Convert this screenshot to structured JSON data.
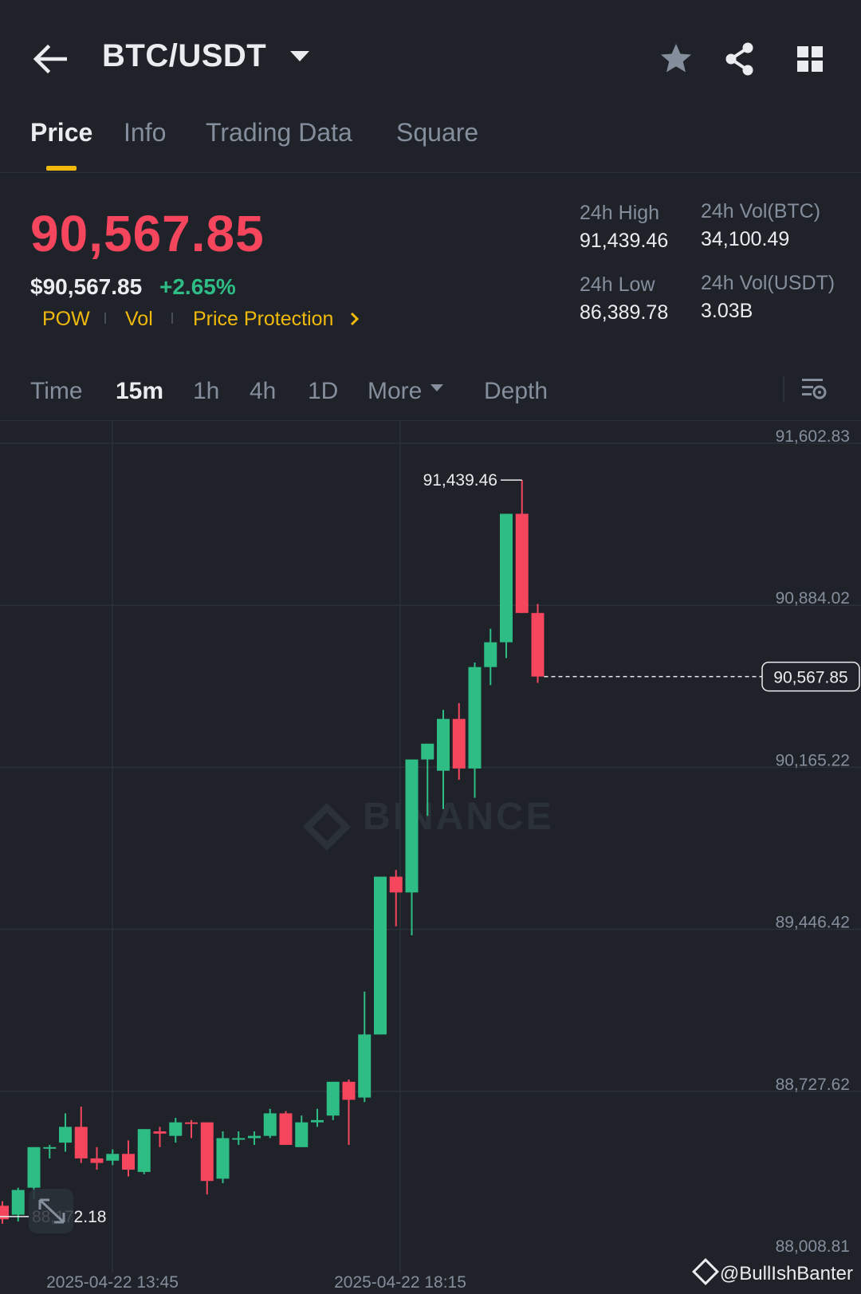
{
  "header": {
    "pair": "BTC/USDT",
    "icons": [
      "back-arrow-icon",
      "star-icon",
      "share-icon",
      "grid-icon"
    ]
  },
  "tabs": [
    {
      "label": "Price",
      "active": true
    },
    {
      "label": "Info",
      "active": false
    },
    {
      "label": "Trading Data",
      "active": false
    },
    {
      "label": "Square",
      "active": false
    }
  ],
  "price": {
    "last": "90,567.85",
    "usd": "$90,567.85",
    "change_pct": "+2.65%",
    "tags": [
      "POW",
      "Vol",
      "Price Protection"
    ]
  },
  "stats": {
    "high_label": "24h High",
    "high_value": "91,439.46",
    "low_label": "24h Low",
    "low_value": "86,389.78",
    "vol_btc_label": "24h Vol(BTC)",
    "vol_btc_value": "34,100.49",
    "vol_usdt_label": "24h Vol(USDT)",
    "vol_usdt_value": "3.03B"
  },
  "intervals": {
    "items": [
      "Time",
      "15m",
      "1h",
      "4h",
      "1D",
      "More"
    ],
    "active": "15m",
    "depth": "Depth"
  },
  "colors": {
    "up": "#2ebd85",
    "down": "#f6465d",
    "accent": "#f0b90b",
    "bg": "#1f2329"
  },
  "watermark": "BINANCE",
  "credit": "@BullIshBanter",
  "chart_data": {
    "type": "candlestick",
    "interval": "15m",
    "y_ticks": [
      "91,602.83",
      "90,884.02",
      "90,165.22",
      "89,446.42",
      "88,727.62",
      "88,008.81"
    ],
    "x_ticks": [
      "2025-04-22 13:45",
      "2025-04-22 18:15"
    ],
    "ylim": [
      88008.81,
      91602.83
    ],
    "high_marker": {
      "label": "91,439.46",
      "value": 91439.46
    },
    "low_marker": {
      "label": "88,172.18",
      "value": 88172.18
    },
    "last_price": {
      "label": "90,567.85",
      "value": 90567.85
    },
    "candles": [
      {
        "o": 88220,
        "h": 88240,
        "c": 88160,
        "l": 88140
      },
      {
        "o": 88180,
        "h": 88300,
        "c": 88290,
        "l": 88150
      },
      {
        "o": 88300,
        "h": 88480,
        "c": 88480,
        "l": 88250
      },
      {
        "o": 88480,
        "h": 88490,
        "c": 88480,
        "l": 88430
      },
      {
        "o": 88500,
        "h": 88630,
        "c": 88570,
        "l": 88460
      },
      {
        "o": 88570,
        "h": 88660,
        "c": 88430,
        "l": 88410
      },
      {
        "o": 88430,
        "h": 88480,
        "c": 88410,
        "l": 88380
      },
      {
        "o": 88420,
        "h": 88470,
        "c": 88450,
        "l": 88400
      },
      {
        "o": 88450,
        "h": 88510,
        "c": 88380,
        "l": 88350
      },
      {
        "o": 88370,
        "h": 88560,
        "c": 88560,
        "l": 88360
      },
      {
        "o": 88550,
        "h": 88570,
        "c": 88540,
        "l": 88480
      },
      {
        "o": 88530,
        "h": 88610,
        "c": 88590,
        "l": 88500
      },
      {
        "o": 88590,
        "h": 88600,
        "c": 88585,
        "l": 88520
      },
      {
        "o": 88590,
        "h": 88590,
        "c": 88330,
        "l": 88270
      },
      {
        "o": 88340,
        "h": 88550,
        "c": 88520,
        "l": 88320
      },
      {
        "o": 88520,
        "h": 88550,
        "c": 88520,
        "l": 88490
      },
      {
        "o": 88520,
        "h": 88550,
        "c": 88530,
        "l": 88490
      },
      {
        "o": 88530,
        "h": 88650,
        "c": 88630,
        "l": 88520
      },
      {
        "o": 88630,
        "h": 88640,
        "c": 88490,
        "l": 88490
      },
      {
        "o": 88480,
        "h": 88620,
        "c": 88590,
        "l": 88480
      },
      {
        "o": 88590,
        "h": 88650,
        "c": 88600,
        "l": 88570
      },
      {
        "o": 88620,
        "h": 88770,
        "c": 88770,
        "l": 88600
      },
      {
        "o": 88770,
        "h": 88780,
        "c": 88690,
        "l": 88490
      },
      {
        "o": 88700,
        "h": 89170,
        "c": 88980,
        "l": 88680
      },
      {
        "o": 88980,
        "h": 89680,
        "c": 89680,
        "l": 88980
      },
      {
        "o": 89680,
        "h": 89710,
        "c": 89610,
        "l": 89460
      },
      {
        "o": 89610,
        "h": 90200,
        "c": 90200,
        "l": 89420
      },
      {
        "o": 90200,
        "h": 90270,
        "c": 90270,
        "l": 89950
      },
      {
        "o": 90150,
        "h": 90420,
        "c": 90380,
        "l": 89980
      },
      {
        "o": 90380,
        "h": 90450,
        "c": 90160,
        "l": 90110
      },
      {
        "o": 90160,
        "h": 90630,
        "c": 90610,
        "l": 90030
      },
      {
        "o": 90610,
        "h": 90780,
        "c": 90720,
        "l": 90530
      },
      {
        "o": 90720,
        "h": 91290,
        "c": 91290,
        "l": 90650
      },
      {
        "o": 91290,
        "h": 91439.46,
        "c": 90850,
        "l": 90850
      },
      {
        "o": 90850,
        "h": 90890,
        "c": 90567.85,
        "l": 90540
      }
    ]
  }
}
